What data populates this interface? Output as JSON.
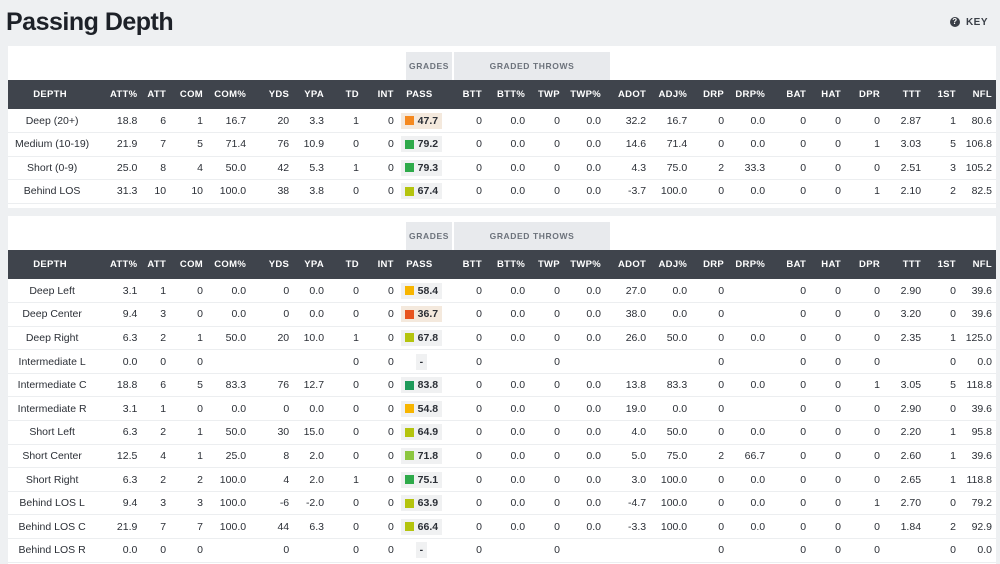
{
  "page": {
    "title": "Passing Depth",
    "key_label": "KEY"
  },
  "groups": {
    "grades": "GRADES",
    "graded_throws": "GRADED THROWS"
  },
  "columns": [
    "DEPTH",
    "ATT%",
    "ATT",
    "COM",
    "COM%",
    "YDS",
    "YPA",
    "TD",
    "INT",
    "PASS",
    "BTT",
    "BTT%",
    "TWP",
    "TWP%",
    "ADOT",
    "ADJ%",
    "DRP",
    "DRP%",
    "BAT",
    "HAT",
    "DPR",
    "TTT",
    "1ST",
    "NFL"
  ],
  "colors": {
    "orange_red": "#e8541e",
    "orange": "#f5891f",
    "yellow": "#f7b500",
    "yellow_green": "#b4c40e",
    "lime": "#8cc63f",
    "green": "#2eaa4a",
    "dark_green": "#1e9a5a"
  },
  "table1": [
    {
      "depth": "Deep (20+)",
      "att_pct": "18.8",
      "att": "6",
      "com": "1",
      "com_pct": "16.7",
      "yds": "20",
      "ypa": "3.3",
      "td": "1",
      "int": "0",
      "pass": "47.7",
      "pass_color": "#f5891f",
      "btt": "0",
      "btt_pct": "0.0",
      "twp": "0",
      "twp_pct": "0.0",
      "adot": "32.2",
      "adj_pct": "16.7",
      "drp": "0",
      "drp_pct": "0.0",
      "bat": "0",
      "hat": "0",
      "dpr": "0",
      "ttt": "2.87",
      "first": "1",
      "nfl": "80.6"
    },
    {
      "depth": "Medium (10-19)",
      "att_pct": "21.9",
      "att": "7",
      "com": "5",
      "com_pct": "71.4",
      "yds": "76",
      "ypa": "10.9",
      "td": "0",
      "int": "0",
      "pass": "79.2",
      "pass_color": "#2eaa4a",
      "btt": "0",
      "btt_pct": "0.0",
      "twp": "0",
      "twp_pct": "0.0",
      "adot": "14.6",
      "adj_pct": "71.4",
      "drp": "0",
      "drp_pct": "0.0",
      "bat": "0",
      "hat": "0",
      "dpr": "1",
      "ttt": "3.03",
      "first": "5",
      "nfl": "106.8"
    },
    {
      "depth": "Short (0-9)",
      "att_pct": "25.0",
      "att": "8",
      "com": "4",
      "com_pct": "50.0",
      "yds": "42",
      "ypa": "5.3",
      "td": "1",
      "int": "0",
      "pass": "79.3",
      "pass_color": "#2eaa4a",
      "btt": "0",
      "btt_pct": "0.0",
      "twp": "0",
      "twp_pct": "0.0",
      "adot": "4.3",
      "adj_pct": "75.0",
      "drp": "2",
      "drp_pct": "33.3",
      "bat": "0",
      "hat": "0",
      "dpr": "0",
      "ttt": "2.51",
      "first": "3",
      "nfl": "105.2"
    },
    {
      "depth": "Behind LOS",
      "att_pct": "31.3",
      "att": "10",
      "com": "10",
      "com_pct": "100.0",
      "yds": "38",
      "ypa": "3.8",
      "td": "0",
      "int": "0",
      "pass": "67.4",
      "pass_color": "#b4c40e",
      "btt": "0",
      "btt_pct": "0.0",
      "twp": "0",
      "twp_pct": "0.0",
      "adot": "-3.7",
      "adj_pct": "100.0",
      "drp": "0",
      "drp_pct": "0.0",
      "bat": "0",
      "hat": "0",
      "dpr": "1",
      "ttt": "2.10",
      "first": "2",
      "nfl": "82.5"
    }
  ],
  "table2": [
    {
      "depth": "Deep Left",
      "att_pct": "3.1",
      "att": "1",
      "com": "0",
      "com_pct": "0.0",
      "yds": "0",
      "ypa": "0.0",
      "td": "0",
      "int": "0",
      "pass": "58.4",
      "pass_color": "#f7b500",
      "btt": "0",
      "btt_pct": "0.0",
      "twp": "0",
      "twp_pct": "0.0",
      "adot": "27.0",
      "adj_pct": "0.0",
      "drp": "0",
      "drp_pct": "",
      "bat": "0",
      "hat": "0",
      "dpr": "0",
      "ttt": "2.90",
      "first": "0",
      "nfl": "39.6"
    },
    {
      "depth": "Deep Center",
      "att_pct": "9.4",
      "att": "3",
      "com": "0",
      "com_pct": "0.0",
      "yds": "0",
      "ypa": "0.0",
      "td": "0",
      "int": "0",
      "pass": "36.7",
      "pass_color": "#e8541e",
      "btt": "0",
      "btt_pct": "0.0",
      "twp": "0",
      "twp_pct": "0.0",
      "adot": "38.0",
      "adj_pct": "0.0",
      "drp": "0",
      "drp_pct": "",
      "bat": "0",
      "hat": "0",
      "dpr": "0",
      "ttt": "3.20",
      "first": "0",
      "nfl": "39.6"
    },
    {
      "depth": "Deep Right",
      "att_pct": "6.3",
      "att": "2",
      "com": "1",
      "com_pct": "50.0",
      "yds": "20",
      "ypa": "10.0",
      "td": "1",
      "int": "0",
      "pass": "67.8",
      "pass_color": "#b4c40e",
      "btt": "0",
      "btt_pct": "0.0",
      "twp": "0",
      "twp_pct": "0.0",
      "adot": "26.0",
      "adj_pct": "50.0",
      "drp": "0",
      "drp_pct": "0.0",
      "bat": "0",
      "hat": "0",
      "dpr": "0",
      "ttt": "2.35",
      "first": "1",
      "nfl": "125.0"
    },
    {
      "depth": "Intermediate L",
      "att_pct": "0.0",
      "att": "0",
      "com": "0",
      "com_pct": "",
      "yds": "",
      "ypa": "",
      "td": "0",
      "int": "0",
      "pass": "-",
      "pass_color": "",
      "btt": "0",
      "btt_pct": "",
      "twp": "0",
      "twp_pct": "",
      "adot": "",
      "adj_pct": "",
      "drp": "0",
      "drp_pct": "",
      "bat": "0",
      "hat": "0",
      "dpr": "0",
      "ttt": "",
      "first": "0",
      "nfl": "0.0"
    },
    {
      "depth": "Intermediate C",
      "att_pct": "18.8",
      "att": "6",
      "com": "5",
      "com_pct": "83.3",
      "yds": "76",
      "ypa": "12.7",
      "td": "0",
      "int": "0",
      "pass": "83.8",
      "pass_color": "#1e9a5a",
      "btt": "0",
      "btt_pct": "0.0",
      "twp": "0",
      "twp_pct": "0.0",
      "adot": "13.8",
      "adj_pct": "83.3",
      "drp": "0",
      "drp_pct": "0.0",
      "bat": "0",
      "hat": "0",
      "dpr": "1",
      "ttt": "3.05",
      "first": "5",
      "nfl": "118.8"
    },
    {
      "depth": "Intermediate R",
      "att_pct": "3.1",
      "att": "1",
      "com": "0",
      "com_pct": "0.0",
      "yds": "0",
      "ypa": "0.0",
      "td": "0",
      "int": "0",
      "pass": "54.8",
      "pass_color": "#f7b500",
      "btt": "0",
      "btt_pct": "0.0",
      "twp": "0",
      "twp_pct": "0.0",
      "adot": "19.0",
      "adj_pct": "0.0",
      "drp": "0",
      "drp_pct": "",
      "bat": "0",
      "hat": "0",
      "dpr": "0",
      "ttt": "2.90",
      "first": "0",
      "nfl": "39.6"
    },
    {
      "depth": "Short Left",
      "att_pct": "6.3",
      "att": "2",
      "com": "1",
      "com_pct": "50.0",
      "yds": "30",
      "ypa": "15.0",
      "td": "0",
      "int": "0",
      "pass": "64.9",
      "pass_color": "#b4c40e",
      "btt": "0",
      "btt_pct": "0.0",
      "twp": "0",
      "twp_pct": "0.0",
      "adot": "4.0",
      "adj_pct": "50.0",
      "drp": "0",
      "drp_pct": "0.0",
      "bat": "0",
      "hat": "0",
      "dpr": "0",
      "ttt": "2.20",
      "first": "1",
      "nfl": "95.8"
    },
    {
      "depth": "Short Center",
      "att_pct": "12.5",
      "att": "4",
      "com": "1",
      "com_pct": "25.0",
      "yds": "8",
      "ypa": "2.0",
      "td": "0",
      "int": "0",
      "pass": "71.8",
      "pass_color": "#8cc63f",
      "btt": "0",
      "btt_pct": "0.0",
      "twp": "0",
      "twp_pct": "0.0",
      "adot": "5.0",
      "adj_pct": "75.0",
      "drp": "2",
      "drp_pct": "66.7",
      "bat": "0",
      "hat": "0",
      "dpr": "0",
      "ttt": "2.60",
      "first": "1",
      "nfl": "39.6"
    },
    {
      "depth": "Short Right",
      "att_pct": "6.3",
      "att": "2",
      "com": "2",
      "com_pct": "100.0",
      "yds": "4",
      "ypa": "2.0",
      "td": "1",
      "int": "0",
      "pass": "75.1",
      "pass_color": "#2eaa4a",
      "btt": "0",
      "btt_pct": "0.0",
      "twp": "0",
      "twp_pct": "0.0",
      "adot": "3.0",
      "adj_pct": "100.0",
      "drp": "0",
      "drp_pct": "0.0",
      "bat": "0",
      "hat": "0",
      "dpr": "0",
      "ttt": "2.65",
      "first": "1",
      "nfl": "118.8"
    },
    {
      "depth": "Behind LOS L",
      "att_pct": "9.4",
      "att": "3",
      "com": "3",
      "com_pct": "100.0",
      "yds": "-6",
      "ypa": "-2.0",
      "td": "0",
      "int": "0",
      "pass": "63.9",
      "pass_color": "#b4c40e",
      "btt": "0",
      "btt_pct": "0.0",
      "twp": "0",
      "twp_pct": "0.0",
      "adot": "-4.7",
      "adj_pct": "100.0",
      "drp": "0",
      "drp_pct": "0.0",
      "bat": "0",
      "hat": "0",
      "dpr": "1",
      "ttt": "2.70",
      "first": "0",
      "nfl": "79.2"
    },
    {
      "depth": "Behind LOS C",
      "att_pct": "21.9",
      "att": "7",
      "com": "7",
      "com_pct": "100.0",
      "yds": "44",
      "ypa": "6.3",
      "td": "0",
      "int": "0",
      "pass": "66.4",
      "pass_color": "#b4c40e",
      "btt": "0",
      "btt_pct": "0.0",
      "twp": "0",
      "twp_pct": "0.0",
      "adot": "-3.3",
      "adj_pct": "100.0",
      "drp": "0",
      "drp_pct": "0.0",
      "bat": "0",
      "hat": "0",
      "dpr": "0",
      "ttt": "1.84",
      "first": "2",
      "nfl": "92.9"
    },
    {
      "depth": "Behind LOS R",
      "att_pct": "0.0",
      "att": "0",
      "com": "0",
      "com_pct": "",
      "yds": "0",
      "ypa": "",
      "td": "0",
      "int": "0",
      "pass": "-",
      "pass_color": "",
      "btt": "0",
      "btt_pct": "",
      "twp": "0",
      "twp_pct": "",
      "adot": "",
      "adj_pct": "",
      "drp": "0",
      "drp_pct": "",
      "bat": "0",
      "hat": "0",
      "dpr": "0",
      "ttt": "",
      "first": "0",
      "nfl": "0.0"
    }
  ]
}
